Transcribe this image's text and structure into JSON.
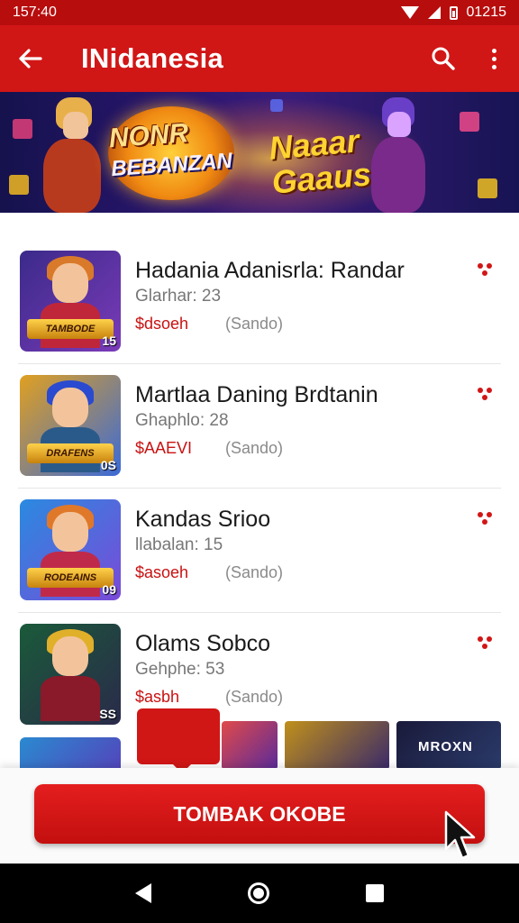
{
  "status_bar": {
    "time": "157:40",
    "right_time": "01215"
  },
  "app_bar": {
    "title": "INidanesia",
    "back_icon": "arrow-left-icon",
    "search_icon": "search-icon",
    "menu_icon": "kebab-menu-icon"
  },
  "banner": {
    "logo_line1": "NONR",
    "logo_line2": "BEBANZAN",
    "title_line1": "Naaar",
    "title_line2": "Gaaus"
  },
  "items": [
    {
      "name": "Hadania Adanisrla: Randar",
      "meta": "Glarhar: 23",
      "price": "$dsoeh",
      "tag": "(Sando)",
      "thumb_label": "TAMBODE",
      "thumb_num": "15"
    },
    {
      "name": "Martlaa Daning Brdtanin",
      "meta": "Ghaphlo: 28",
      "price": "$AAEVI",
      "tag": "(Sando)",
      "thumb_label": "DRAFENS",
      "thumb_num": "0S"
    },
    {
      "name": "Kandas Srioo",
      "meta": "llabalan: 15",
      "price": "$asoeh",
      "tag": "(Sando)",
      "thumb_label": "RODEAINS",
      "thumb_num": "09"
    },
    {
      "name": "Olams Sobco",
      "meta": "Gehphe: 53",
      "price": "$asbh",
      "tag": "(Sando)",
      "thumb_label": "",
      "thumb_num": "SS"
    }
  ],
  "strip": {
    "card_label": "MROXN"
  },
  "cta": {
    "label": "TOMBAK OKOBE"
  },
  "colors": {
    "primary": "#d11616",
    "status_bar": "#b80d0d",
    "price": "#c91212"
  }
}
